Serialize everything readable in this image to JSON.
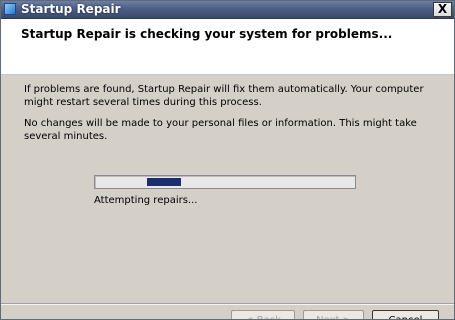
{
  "window": {
    "title": "Startup Repair",
    "close_label": "X"
  },
  "header": {
    "heading": "Startup Repair is checking your system for problems..."
  },
  "body": {
    "paragraph1": "If problems are found, Startup Repair will fix them automatically. Your computer might restart several times during this process.",
    "paragraph2": "No changes will be made to your personal files or information. This might take several minutes."
  },
  "progress": {
    "type": "marquee",
    "segment_start_fraction": 0.2,
    "segment_width_fraction": 0.13,
    "fill_color": "#1d2e6e",
    "status_text": "Attempting repairs..."
  },
  "buttons": {
    "back_label": "< Back",
    "next_label": "Next >",
    "cancel_label": "Cancel"
  },
  "icons": {
    "app": "startup-repair-icon",
    "close": "close-icon"
  }
}
